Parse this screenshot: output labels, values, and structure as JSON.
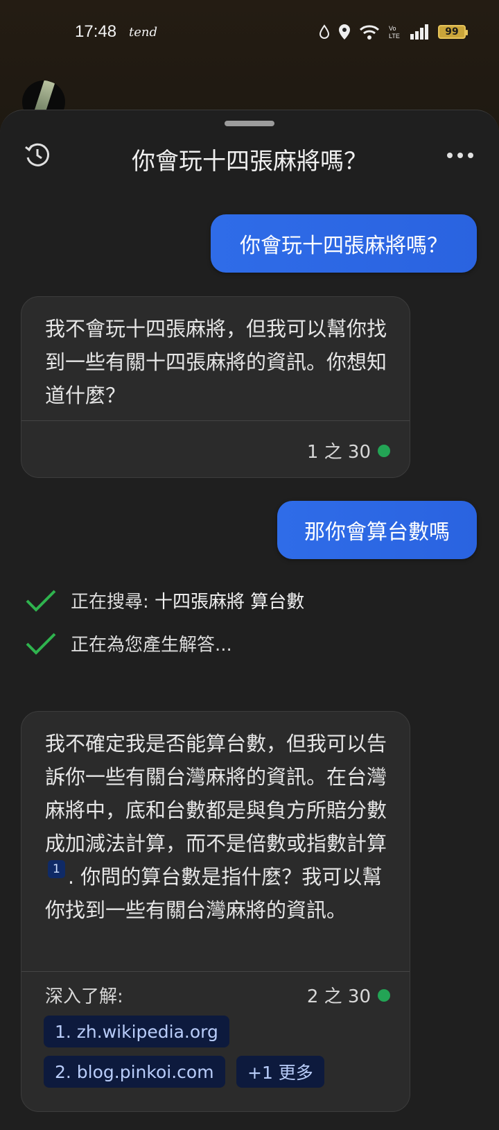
{
  "status_bar": {
    "time": "17:48",
    "carrier": "tend",
    "battery": "99"
  },
  "header": {
    "title": "你會玩十四張麻將嗎？"
  },
  "messages": {
    "user_1": "你會玩十四張麻將嗎？",
    "bot_1": {
      "text": "我不會玩十四張麻將，但我可以幫你找到一些有關十四張麻將的資訊。你想知道什麼？",
      "counter": "1 之 30"
    },
    "user_2": "那你會算台數嗎",
    "steps": [
      {
        "prefix": "正在搜尋: ",
        "query": "十四張麻將 算台數"
      },
      {
        "prefix": "正在為您產生解答...",
        "query": ""
      }
    ],
    "bot_2": {
      "text_before": "我不確定我是否能算台數，但我可以告訴你一些有關台灣麻將的資訊。在台灣麻將中，底和台數都是與負方所賠分數成加減法計算，而不是倍數或指數計算",
      "cite": "1",
      "text_after": ". 你問的算台數是指什麼？我可以幫你找到一些有關台灣麻將的資訊。",
      "learn_more": "深入了解:",
      "counter": "2 之 30",
      "sources": [
        "1. zh.wikipedia.org",
        "2. blog.pinkoi.com"
      ],
      "more": "+1 更多"
    }
  },
  "colors": {
    "accent": "#2f6ce8",
    "status_green": "#23a455",
    "check_green": "#2fb34e"
  }
}
